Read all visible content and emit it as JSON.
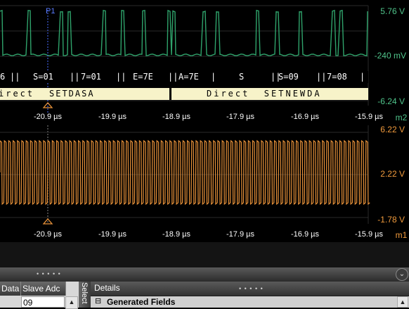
{
  "upper_channel": {
    "marker": "P1",
    "top_level": "5.76 V",
    "mid_level": "-240 mV",
    "bottom_level": "-6.24 V",
    "channel_label": "m2",
    "color": "#2fa36b"
  },
  "decode": {
    "symbols": [
      "6",
      "S=01",
      "7=01",
      "E=7E",
      "A=7E",
      "S",
      "S=09",
      "7=08"
    ],
    "commands": [
      "irect",
      "SETDASA",
      "Direct  SETNEWDA"
    ]
  },
  "time_axis": {
    "ticks": [
      "-20.9 µs",
      "-19.9 µs",
      "-18.9 µs",
      "-17.9 µs",
      "-16.9 µs",
      "-15.9 µs"
    ]
  },
  "lower_channel": {
    "top_level": "6.22 V",
    "mid_level": "2.22 V",
    "bottom_level": "-1.78 V",
    "channel_label": "m1",
    "color": "#e8923a"
  },
  "bottom_panel": {
    "columns": [
      "Data",
      "Slave Adc"
    ],
    "cell_value": "09",
    "select_label": "Select",
    "details_title": "Details",
    "generated_fields": "Generated Fields",
    "expand_glyph": "⊟"
  }
}
